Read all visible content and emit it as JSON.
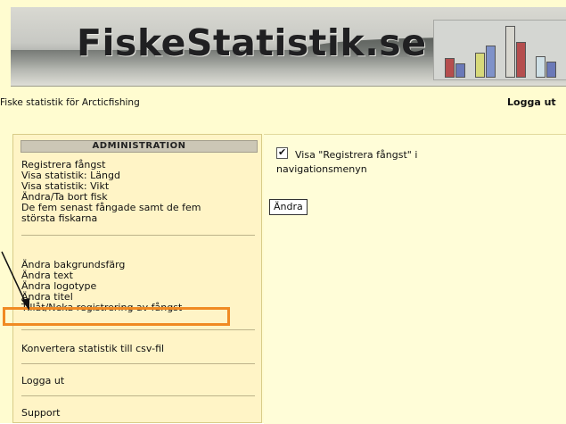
{
  "header": {
    "brand_title": "FiskeStatistik.se",
    "tagline": "Fiske statistik för Arcticfishing",
    "logout_label": "Logga ut"
  },
  "sidebar": {
    "section_title": "ADMINISTRATION",
    "group1": [
      "Registrera fångst",
      "Visa statistik: Längd",
      "Visa statistik: Vikt",
      "Ändra/Ta bort fisk",
      "De fem senast fångade samt de fem",
      "största fiskarna"
    ],
    "group2": [
      "Ändra bakgrundsfärg",
      "Ändra text",
      "Ändra logotype",
      "Ändra titel",
      "Tillåt/Neka registrering av fångst"
    ],
    "convert_label": "Konvertera statistik till csv-fil",
    "logout_label": "Logga ut",
    "support_label": "Support"
  },
  "main": {
    "checkbox_checked": true,
    "checkbox_label_line1": "Visa \"Registrera fångst\" i",
    "checkbox_label_line2": "navigationsmenyn",
    "apply_label": "Ändra"
  },
  "colors": {
    "highlight_border": "#f08a23",
    "page_background": "#fffcd0",
    "sidebar_background": "#fff4c6"
  }
}
